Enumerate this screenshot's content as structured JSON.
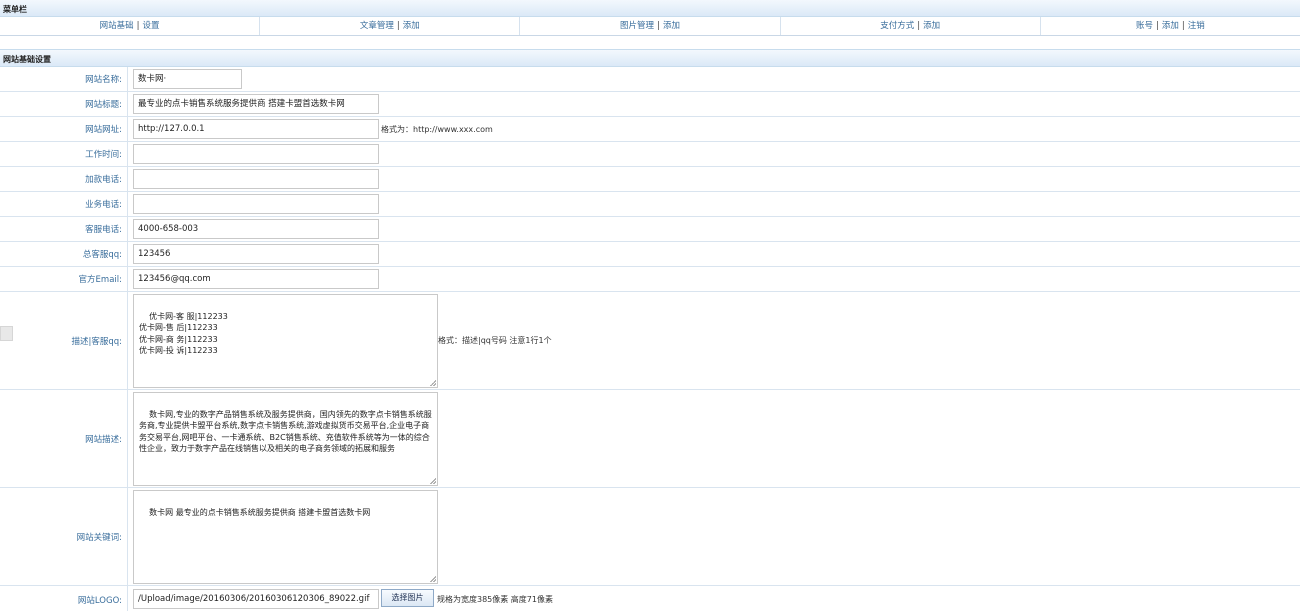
{
  "menubar": {
    "title": "菜单栏",
    "items": [
      {
        "text": "网站基础",
        "action": "设置"
      },
      {
        "text": "文章管理",
        "action": "添加"
      },
      {
        "text": "图片管理",
        "action": "添加"
      },
      {
        "text": "支付方式",
        "action": "添加"
      },
      {
        "text": "账号",
        "action": "添加",
        "action2": "注销"
      }
    ],
    "separator": "|"
  },
  "section": {
    "title": "网站基础设置"
  },
  "fields": {
    "site_name": {
      "label": "网站名称:",
      "value": "数卡网·"
    },
    "site_title": {
      "label": "网站标题:",
      "value": "最专业的点卡销售系统服务提供商 搭建卡盟首选数卡网"
    },
    "site_url": {
      "label": "网站网址:",
      "value": "http://127.0.0.1",
      "hint": "格式为：http://www.xxx.com"
    },
    "work_hours": {
      "label": "工作时间:",
      "value": ""
    },
    "payment_phone": {
      "label": "加款电话:",
      "value": ""
    },
    "business_phone": {
      "label": "业务电话:",
      "value": ""
    },
    "service_phone": {
      "label": "客服电话:",
      "value": "4000-658-003"
    },
    "main_qq": {
      "label": "总客服qq:",
      "value": "123456"
    },
    "email": {
      "label": "官方Email:",
      "value": "123456@qq.com"
    },
    "qq_desc": {
      "label": "描述|客服qq:",
      "value": "优卡网-客 服|112233\n优卡网-售 后|112233\n优卡网-商 务|112233\n优卡网-投 诉|112233",
      "hint": "格式：描述|qq号码 注意1行1个"
    },
    "site_desc": {
      "label": "网站描述:",
      "value": "数卡网,专业的数字产品销售系统及服务提供商，国内领先的数字点卡销售系统服务商,专业提供卡盟平台系统,数字点卡销售系统,游戏虚拟货币交易平台,企业电子商务交易平台,网吧平台、一卡通系统、B2C销售系统、充值软件系统等为一体的综合性企业，致力于数字产品在线销售以及相关的电子商务领域的拓展和服务"
    },
    "site_keywords": {
      "label": "网站关键词:",
      "value": "数卡网 最专业的点卡销售系统服务提供商 搭建卡盟首选数卡网"
    },
    "site_logo": {
      "label": "网站LOGO:",
      "value": "/Upload/image/20160306/20160306120306_89022.gif",
      "button": "选择图片",
      "hint": "规格为宽度385像素 高度71像素"
    }
  }
}
